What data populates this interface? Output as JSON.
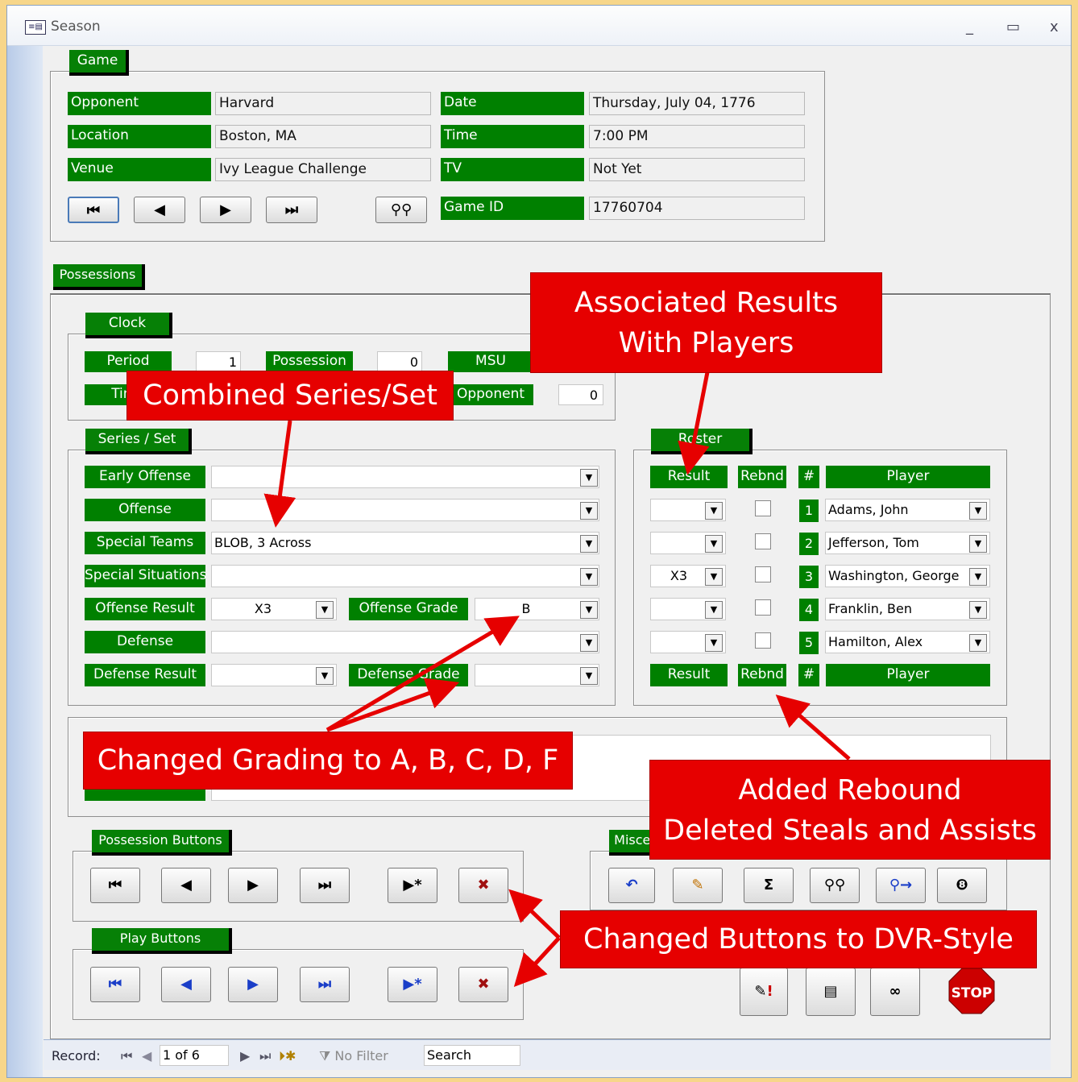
{
  "window": {
    "title": "Season",
    "minimize": "_",
    "maximize": "▭",
    "close": "x"
  },
  "game": {
    "section_label": "Game",
    "rows": [
      {
        "label": "Opponent",
        "value": "Harvard"
      },
      {
        "label": "Location",
        "value": "Boston, MA"
      },
      {
        "label": "Venue",
        "value": "Ivy League Challenge"
      }
    ],
    "right_rows": [
      {
        "label": "Date",
        "value": "Thursday, July 04, 1776"
      },
      {
        "label": "Time",
        "value": "7:00 PM"
      },
      {
        "label": "TV",
        "value": "Not Yet"
      },
      {
        "label": "Game ID",
        "value": "17760704"
      }
    ]
  },
  "possessions": {
    "section_label": "Possessions",
    "clock": {
      "section_label": "Clock",
      "period_label": "Period",
      "period_value": "1",
      "possession_label": "Possession",
      "possession_value": "0",
      "msu_label": "MSU",
      "time_label": "Time",
      "opponent_label": "Opponent",
      "opponent_value": "0"
    },
    "series_set": {
      "section_label": "Series / Set",
      "early_offense_label": "Early Offense",
      "early_offense_value": "",
      "offense_label": "Offense",
      "offense_value": "",
      "special_teams_label": "Special Teams",
      "special_teams_value": "BLOB, 3 Across",
      "special_situations_label": "Special Situations",
      "special_situations_value": "",
      "offense_result_label": "Offense Result",
      "offense_result_value": "X3",
      "offense_grade_label": "Offense Grade",
      "offense_grade_value": "B",
      "defense_label": "Defense",
      "defense_value": "",
      "defense_result_label": "Defense Result",
      "defense_result_value": "",
      "defense_grade_label": "Defense Grade",
      "defense_grade_value": ""
    },
    "roster": {
      "section_label": "Roster",
      "headers": {
        "result": "Result",
        "rebnd": "Rebnd",
        "num": "#",
        "player": "Player"
      },
      "rows": [
        {
          "result": "",
          "num": "1",
          "player": "Adams, John"
        },
        {
          "result": "",
          "num": "2",
          "player": "Jefferson, Tom"
        },
        {
          "result": "X3",
          "num": "3",
          "player": "Washington, George"
        },
        {
          "result": "",
          "num": "4",
          "player": "Franklin, Ben"
        },
        {
          "result": "",
          "num": "5",
          "player": "Hamilton, Alex"
        }
      ]
    },
    "possession_buttons_label": "Possession Buttons",
    "play_buttons_label": "Play Buttons",
    "misc_label": "Miscel"
  },
  "status": {
    "record_label": "Record:",
    "record_value": "1 of 6",
    "filter_label": "No Filter",
    "search_label": "Search"
  },
  "callouts": {
    "associated": [
      "Associated Results",
      "With Players"
    ],
    "combined": "Combined Series/Set",
    "grading": "Changed Grading to A, B, C, D, F",
    "rebound": [
      "Added Rebound",
      "Deleted Steals and Assists"
    ],
    "dvr": "Changed Buttons to DVR-Style"
  },
  "colors": {
    "label_green": "#008000",
    "callout_red": "#e60000",
    "background": "#f7d68a"
  }
}
